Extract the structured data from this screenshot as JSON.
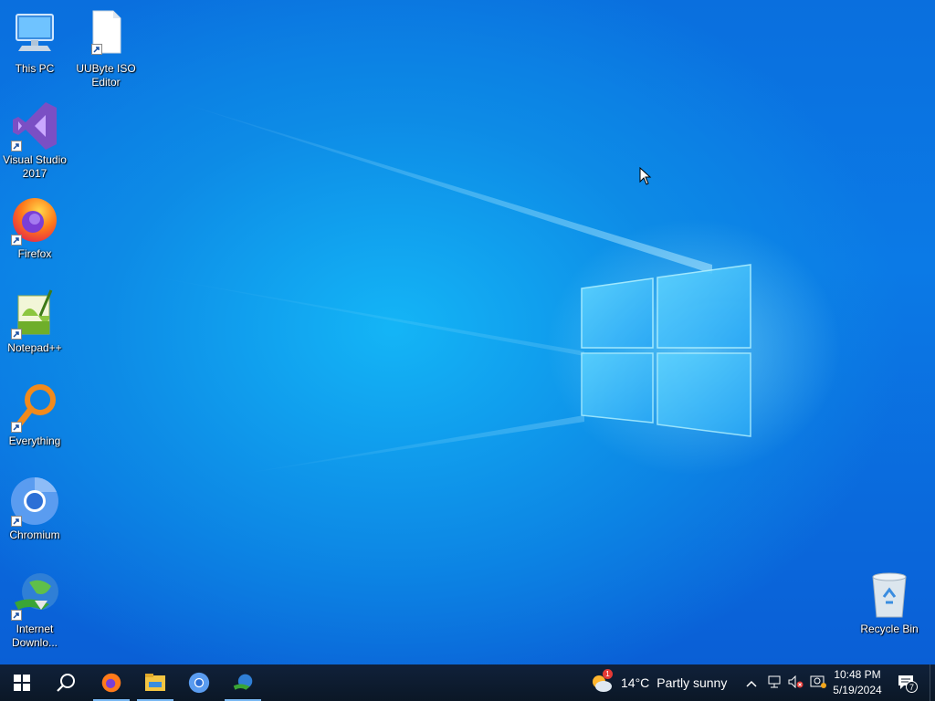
{
  "desktop": {
    "icons": [
      {
        "label": "This PC"
      },
      {
        "label": "UUByte ISO Editor"
      },
      {
        "label": "Visual Studio 2017"
      },
      {
        "label": "Firefox"
      },
      {
        "label": "Notepad++"
      },
      {
        "label": "Everything"
      },
      {
        "label": "Chromium"
      },
      {
        "label": "Internet Downlo..."
      },
      {
        "label": "Recycle Bin"
      }
    ]
  },
  "taskbar": {
    "pinned": [
      "start-icon",
      "search-icon",
      "firefox-icon",
      "file-explorer-icon",
      "chromium-icon",
      "internet-download-manager-icon"
    ],
    "weather": {
      "temperature": "14°C",
      "condition": "Partly sunny",
      "badge": "1"
    },
    "clock": {
      "time": "10:48 PM",
      "date": "5/19/2024"
    },
    "notifications": {
      "count": "7"
    }
  },
  "colors": {
    "accent": "#0a78e6",
    "taskbar": "#0e1a2a"
  }
}
